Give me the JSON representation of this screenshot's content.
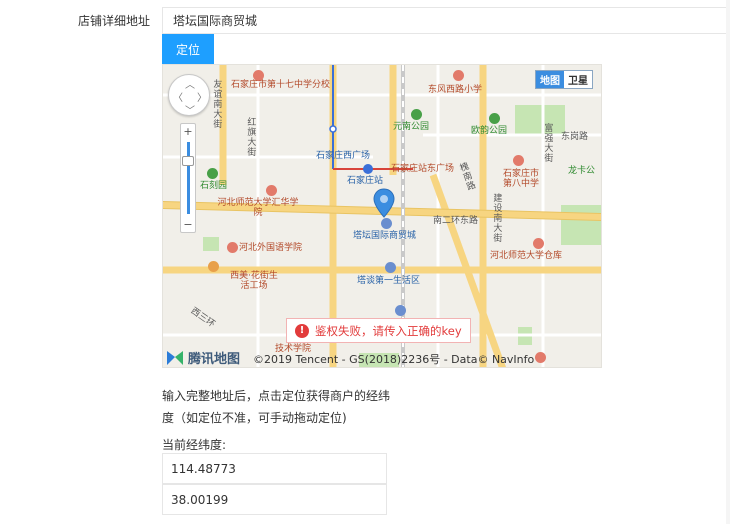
{
  "form": {
    "address_label": "店铺详细地址",
    "address_value": "塔坛国际商贸城",
    "locate_button": "定位",
    "hint": "输入完整地址后，点击定位获得商户的经纬度（如定位不准，可手动拖动定位)",
    "coord_label": "当前经纬度:",
    "longitude": "114.48773",
    "latitude": "38.00199"
  },
  "map": {
    "type_map": "地图",
    "type_satellite": "卫星",
    "error_message": "鉴权失败，请传入正确的key",
    "brand": "腾讯地图",
    "copyright": "©2019 Tencent - GS(2018)2236号 - Data© NavInfo",
    "labels": {
      "l1": "石家庄市第十七中学分校",
      "l2": "东风西路小学",
      "l3": "元南公园",
      "l4": "欧韵公园",
      "l5": "东岗路",
      "l6": "石家庄西广场",
      "l7": "石家庄站东广场",
      "l8": "石家庄站",
      "l9": "石家庄市第八中学",
      "l10": "龙卡公",
      "l11": "石刻园",
      "l12": "河北师范大学汇华学院",
      "l13": "南二环东路",
      "l14": "塔坛国际商贸城",
      "l15": "河北外国语学院",
      "l16": "河北师范大学仓库",
      "l17": "西美·花街生活工场",
      "l18": "塔谈第一生活区",
      "l19": "西三环",
      "l20": "技术学院",
      "v1": "友谊南大街",
      "v2": "红旗大街",
      "v3": "富强大街",
      "v4": "建设南大街",
      "v5": "槐南路"
    }
  },
  "colors": {
    "accent": "#1e9fff",
    "error": "#e23b3b",
    "map_bg": "#f1efe9",
    "road": "#f7d581",
    "park": "#c6e5b3"
  }
}
